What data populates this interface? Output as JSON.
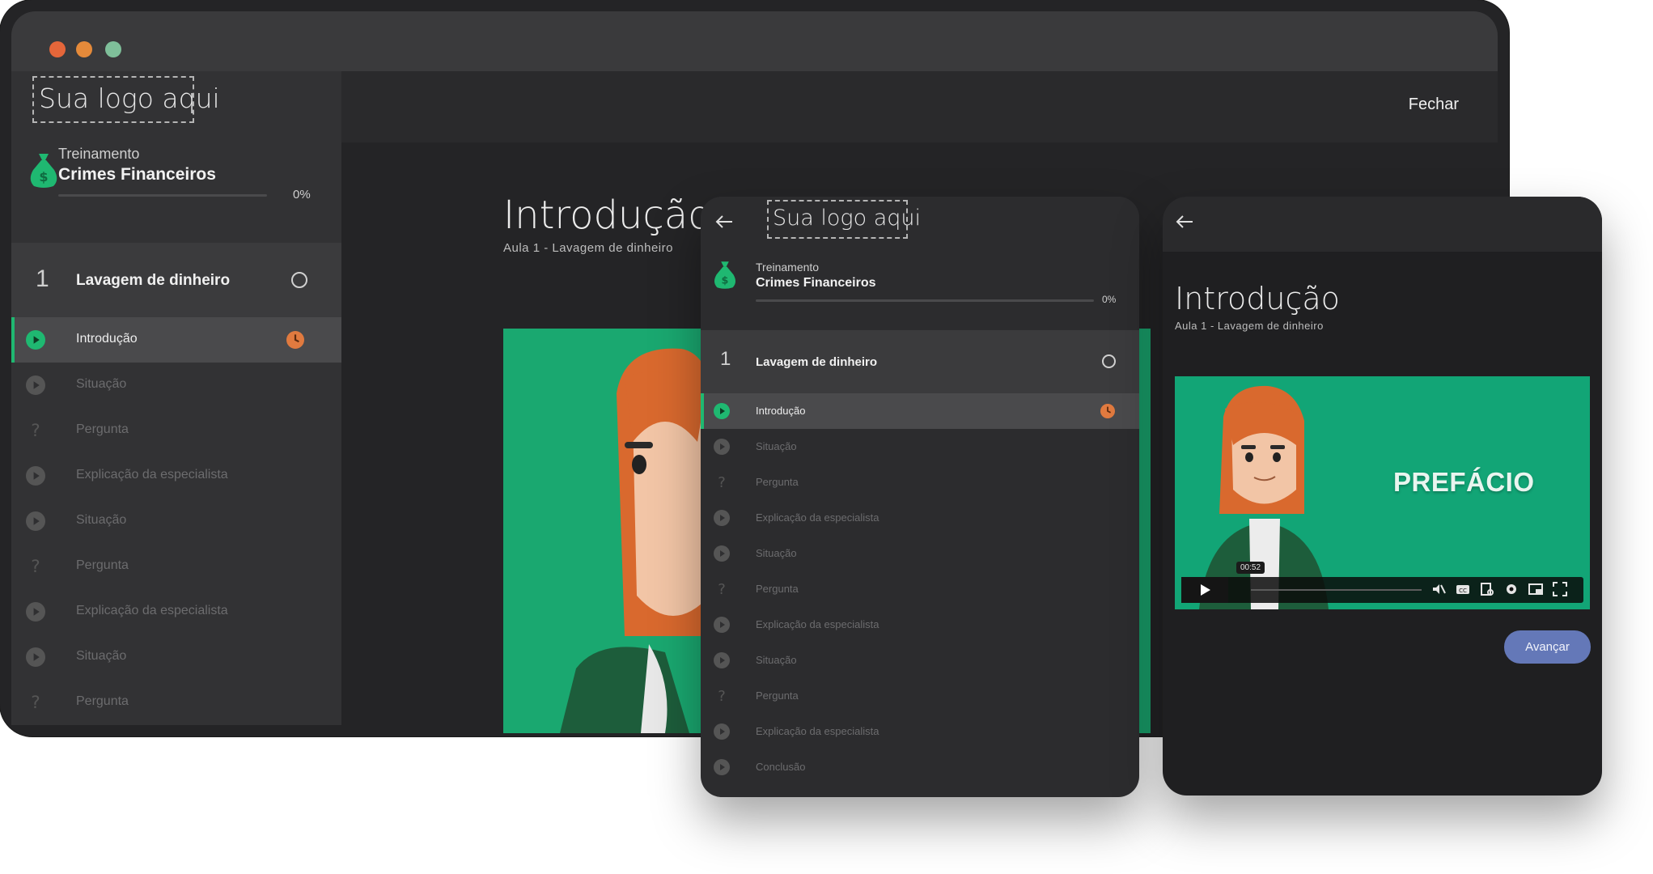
{
  "desktop": {
    "logo_text": "Sua logo aqui",
    "close_label": "Fechar",
    "course_kicker": "Treinamento",
    "course_name": "Crimes Financeiros",
    "progress_pct": "0%",
    "progress_value": 0,
    "module_number": "1",
    "module_title": "Lavagem de dinheiro",
    "lesson_title": "Introdução",
    "lesson_subtitle": "Aula 1 - Lavagem de dinheiro",
    "lessons": [
      {
        "label": "Introdução",
        "icon": "play-icon"
      },
      {
        "label": "Situação",
        "icon": "play-icon"
      },
      {
        "label": "Pergunta",
        "icon": "question-icon"
      },
      {
        "label": "Explicação da especialista",
        "icon": "play-icon"
      },
      {
        "label": "Situação",
        "icon": "play-icon"
      },
      {
        "label": "Pergunta",
        "icon": "question-icon"
      },
      {
        "label": "Explicação da especialista",
        "icon": "play-icon"
      },
      {
        "label": "Situação",
        "icon": "play-icon"
      },
      {
        "label": "Pergunta",
        "icon": "question-icon"
      }
    ]
  },
  "tablet": {
    "logo_text": "Sua logo aqui",
    "course_kicker": "Treinamento",
    "course_name": "Crimes Financeiros",
    "progress_pct": "0%",
    "module_number": "1",
    "module_title": "Lavagem de dinheiro",
    "lessons": [
      {
        "label": "Introdução",
        "icon": "play-icon"
      },
      {
        "label": "Situação",
        "icon": "play-icon"
      },
      {
        "label": "Pergunta",
        "icon": "question-icon"
      },
      {
        "label": "Explicação da especialista",
        "icon": "play-icon"
      },
      {
        "label": "Situação",
        "icon": "play-icon"
      },
      {
        "label": "Pergunta",
        "icon": "question-icon"
      },
      {
        "label": "Explicação da especialista",
        "icon": "play-icon"
      },
      {
        "label": "Situação",
        "icon": "play-icon"
      },
      {
        "label": "Pergunta",
        "icon": "question-icon"
      },
      {
        "label": "Explicação da especialista",
        "icon": "play-icon"
      },
      {
        "label": "Conclusão",
        "icon": "play-icon"
      }
    ]
  },
  "phone": {
    "lesson_title": "Introdução",
    "lesson_subtitle": "Aula 1 - Lavagem de dinheiro",
    "video_caption": "PREFÁCIO",
    "video_time": "00:52",
    "next_button": "Avançar"
  },
  "colors": {
    "accent_green": "#1fb871",
    "video_green": "#12a576",
    "clock_orange": "#e07a3f",
    "button_blue": "#6478b8"
  }
}
